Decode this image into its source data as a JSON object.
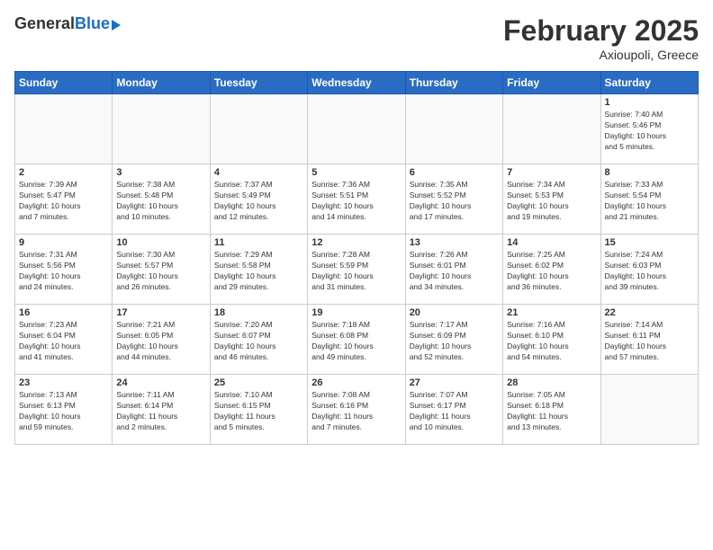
{
  "header": {
    "logo_general": "General",
    "logo_blue": "Blue",
    "title": "February 2025",
    "subtitle": "Axioupoli, Greece"
  },
  "weekdays": [
    "Sunday",
    "Monday",
    "Tuesday",
    "Wednesday",
    "Thursday",
    "Friday",
    "Saturday"
  ],
  "weeks": [
    [
      {
        "day": "",
        "info": ""
      },
      {
        "day": "",
        "info": ""
      },
      {
        "day": "",
        "info": ""
      },
      {
        "day": "",
        "info": ""
      },
      {
        "day": "",
        "info": ""
      },
      {
        "day": "",
        "info": ""
      },
      {
        "day": "1",
        "info": "Sunrise: 7:40 AM\nSunset: 5:46 PM\nDaylight: 10 hours\nand 5 minutes."
      }
    ],
    [
      {
        "day": "2",
        "info": "Sunrise: 7:39 AM\nSunset: 5:47 PM\nDaylight: 10 hours\nand 7 minutes."
      },
      {
        "day": "3",
        "info": "Sunrise: 7:38 AM\nSunset: 5:48 PM\nDaylight: 10 hours\nand 10 minutes."
      },
      {
        "day": "4",
        "info": "Sunrise: 7:37 AM\nSunset: 5:49 PM\nDaylight: 10 hours\nand 12 minutes."
      },
      {
        "day": "5",
        "info": "Sunrise: 7:36 AM\nSunset: 5:51 PM\nDaylight: 10 hours\nand 14 minutes."
      },
      {
        "day": "6",
        "info": "Sunrise: 7:35 AM\nSunset: 5:52 PM\nDaylight: 10 hours\nand 17 minutes."
      },
      {
        "day": "7",
        "info": "Sunrise: 7:34 AM\nSunset: 5:53 PM\nDaylight: 10 hours\nand 19 minutes."
      },
      {
        "day": "8",
        "info": "Sunrise: 7:33 AM\nSunset: 5:54 PM\nDaylight: 10 hours\nand 21 minutes."
      }
    ],
    [
      {
        "day": "9",
        "info": "Sunrise: 7:31 AM\nSunset: 5:56 PM\nDaylight: 10 hours\nand 24 minutes."
      },
      {
        "day": "10",
        "info": "Sunrise: 7:30 AM\nSunset: 5:57 PM\nDaylight: 10 hours\nand 26 minutes."
      },
      {
        "day": "11",
        "info": "Sunrise: 7:29 AM\nSunset: 5:58 PM\nDaylight: 10 hours\nand 29 minutes."
      },
      {
        "day": "12",
        "info": "Sunrise: 7:28 AM\nSunset: 5:59 PM\nDaylight: 10 hours\nand 31 minutes."
      },
      {
        "day": "13",
        "info": "Sunrise: 7:26 AM\nSunset: 6:01 PM\nDaylight: 10 hours\nand 34 minutes."
      },
      {
        "day": "14",
        "info": "Sunrise: 7:25 AM\nSunset: 6:02 PM\nDaylight: 10 hours\nand 36 minutes."
      },
      {
        "day": "15",
        "info": "Sunrise: 7:24 AM\nSunset: 6:03 PM\nDaylight: 10 hours\nand 39 minutes."
      }
    ],
    [
      {
        "day": "16",
        "info": "Sunrise: 7:23 AM\nSunset: 6:04 PM\nDaylight: 10 hours\nand 41 minutes."
      },
      {
        "day": "17",
        "info": "Sunrise: 7:21 AM\nSunset: 6:05 PM\nDaylight: 10 hours\nand 44 minutes."
      },
      {
        "day": "18",
        "info": "Sunrise: 7:20 AM\nSunset: 6:07 PM\nDaylight: 10 hours\nand 46 minutes."
      },
      {
        "day": "19",
        "info": "Sunrise: 7:18 AM\nSunset: 6:08 PM\nDaylight: 10 hours\nand 49 minutes."
      },
      {
        "day": "20",
        "info": "Sunrise: 7:17 AM\nSunset: 6:09 PM\nDaylight: 10 hours\nand 52 minutes."
      },
      {
        "day": "21",
        "info": "Sunrise: 7:16 AM\nSunset: 6:10 PM\nDaylight: 10 hours\nand 54 minutes."
      },
      {
        "day": "22",
        "info": "Sunrise: 7:14 AM\nSunset: 6:11 PM\nDaylight: 10 hours\nand 57 minutes."
      }
    ],
    [
      {
        "day": "23",
        "info": "Sunrise: 7:13 AM\nSunset: 6:13 PM\nDaylight: 10 hours\nand 59 minutes."
      },
      {
        "day": "24",
        "info": "Sunrise: 7:11 AM\nSunset: 6:14 PM\nDaylight: 11 hours\nand 2 minutes."
      },
      {
        "day": "25",
        "info": "Sunrise: 7:10 AM\nSunset: 6:15 PM\nDaylight: 11 hours\nand 5 minutes."
      },
      {
        "day": "26",
        "info": "Sunrise: 7:08 AM\nSunset: 6:16 PM\nDaylight: 11 hours\nand 7 minutes."
      },
      {
        "day": "27",
        "info": "Sunrise: 7:07 AM\nSunset: 6:17 PM\nDaylight: 11 hours\nand 10 minutes."
      },
      {
        "day": "28",
        "info": "Sunrise: 7:05 AM\nSunset: 6:18 PM\nDaylight: 11 hours\nand 13 minutes."
      },
      {
        "day": "",
        "info": ""
      }
    ]
  ]
}
